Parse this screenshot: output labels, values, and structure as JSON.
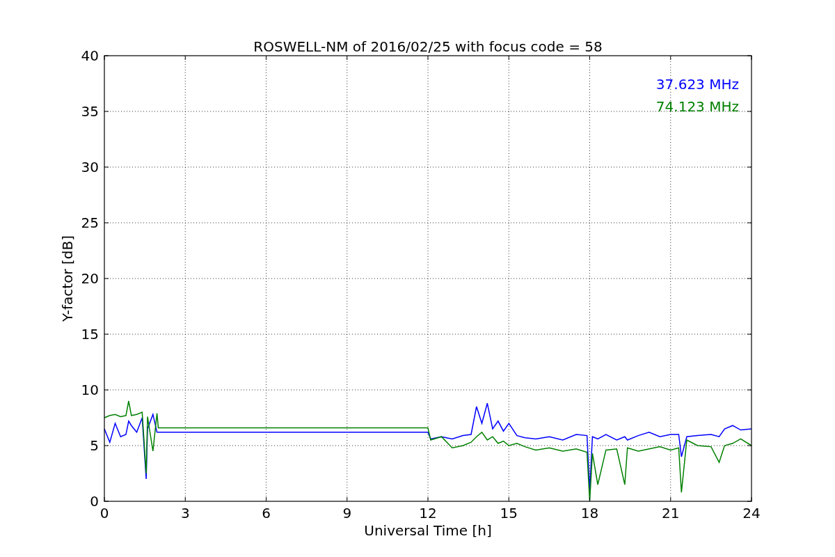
{
  "chart_data": {
    "type": "line",
    "title": "ROSWELL-NM of 2016/02/25 with focus code = 58",
    "xlabel": "Universal Time [h]",
    "ylabel": "Y-factor [dB]",
    "x": [
      0,
      0.2,
      0.4,
      0.6,
      0.8,
      0.9,
      1.0,
      1.2,
      1.4,
      1.55,
      1.6,
      1.8,
      1.95,
      2.0,
      12.0,
      12.1,
      12.5,
      12.9,
      13.3,
      13.6,
      13.8,
      14.0,
      14.2,
      14.4,
      14.6,
      14.8,
      15.0,
      15.3,
      15.6,
      16,
      16.5,
      17,
      17.5,
      17.9,
      18.0,
      18.1,
      18.3,
      18.6,
      19,
      19.3,
      19.4,
      19.8,
      20.2,
      20.6,
      21,
      21.3,
      21.4,
      21.6,
      22,
      22.5,
      22.8,
      23,
      23.3,
      23.6,
      24
    ],
    "series": [
      {
        "name": "37.623 MHz",
        "color": "#0000ff",
        "values": [
          6.5,
          5.3,
          7.0,
          5.8,
          6.0,
          7.2,
          6.8,
          6.2,
          7.5,
          2.0,
          6.5,
          7.8,
          6.2,
          6.2,
          6.2,
          5.6,
          5.8,
          5.6,
          5.9,
          6.0,
          8.5,
          7.0,
          8.8,
          6.5,
          7.2,
          6.3,
          7.0,
          5.9,
          5.7,
          5.6,
          5.8,
          5.5,
          6.0,
          5.9,
          1.0,
          5.8,
          5.6,
          6.0,
          5.5,
          5.8,
          5.5,
          5.9,
          6.2,
          5.8,
          6.0,
          6.0,
          4.0,
          5.8,
          5.9,
          6.0,
          5.8,
          6.5,
          6.8,
          6.4,
          6.5
        ]
      },
      {
        "name": "74.123 MHz",
        "color": "#008000",
        "values": [
          7.5,
          7.7,
          7.8,
          7.6,
          7.7,
          9.0,
          7.7,
          7.8,
          8.0,
          2.5,
          7.6,
          4.5,
          7.9,
          6.6,
          6.6,
          5.5,
          5.8,
          4.8,
          5.0,
          5.3,
          5.8,
          6.2,
          5.5,
          5.8,
          5.2,
          5.4,
          5.0,
          5.2,
          4.9,
          4.6,
          4.8,
          4.5,
          4.7,
          4.4,
          0.0,
          4.3,
          1.5,
          4.6,
          4.7,
          1.5,
          4.8,
          4.5,
          4.7,
          4.9,
          4.6,
          4.8,
          0.8,
          5.5,
          5.0,
          4.9,
          3.5,
          5.0,
          5.2,
          5.6,
          5.0
        ]
      }
    ],
    "grid": true,
    "xlim": [
      0,
      24
    ],
    "ylim": [
      0,
      40
    ],
    "xticks": [
      0,
      3,
      6,
      9,
      12,
      15,
      18,
      21,
      24
    ],
    "yticks": [
      0,
      5,
      10,
      15,
      20,
      25,
      30,
      35,
      40
    ]
  }
}
